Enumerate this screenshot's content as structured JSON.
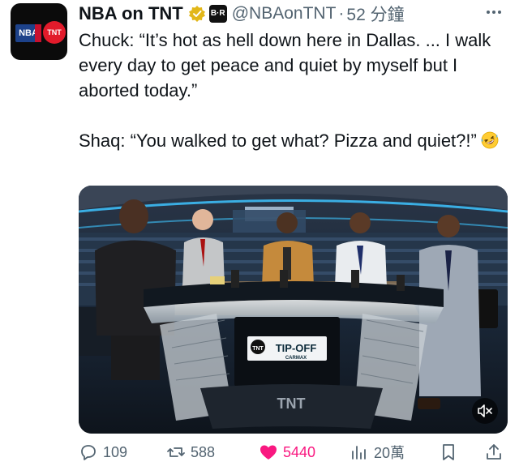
{
  "author": {
    "display_name": "NBA on TNT",
    "handle": "@NBAonTNT",
    "separator": "·",
    "timestamp": "52 分鐘",
    "avatar_text": {
      "left": "NBA",
      "right": "TNT"
    },
    "affiliate_badge": "B·R"
  },
  "tweet": {
    "paragraph1": "Chuck: “It’s hot as hell down here in Dallas. ... I walk every day to get peace and quiet by myself but I aborted today.”",
    "paragraph2": "Shaq: “You walked to get what? Pizza and quiet?!”"
  },
  "media": {
    "desk_banner": "TIP-OFF",
    "desk_banner_sub": "CARMAX",
    "desk_logo": "TNT",
    "screen_brand": "TNT"
  },
  "actions": {
    "replies": "109",
    "reposts": "588",
    "likes": "5440",
    "views": "20萬"
  },
  "colors": {
    "like": "#f91880",
    "verified": "#e2b719",
    "muted_text": "#536471"
  },
  "icons": [
    "more-icon",
    "verified-icon",
    "emoji-rofl",
    "mute-icon",
    "reply-icon",
    "repost-icon",
    "like-icon",
    "views-icon",
    "bookmark-icon",
    "share-icon"
  ]
}
